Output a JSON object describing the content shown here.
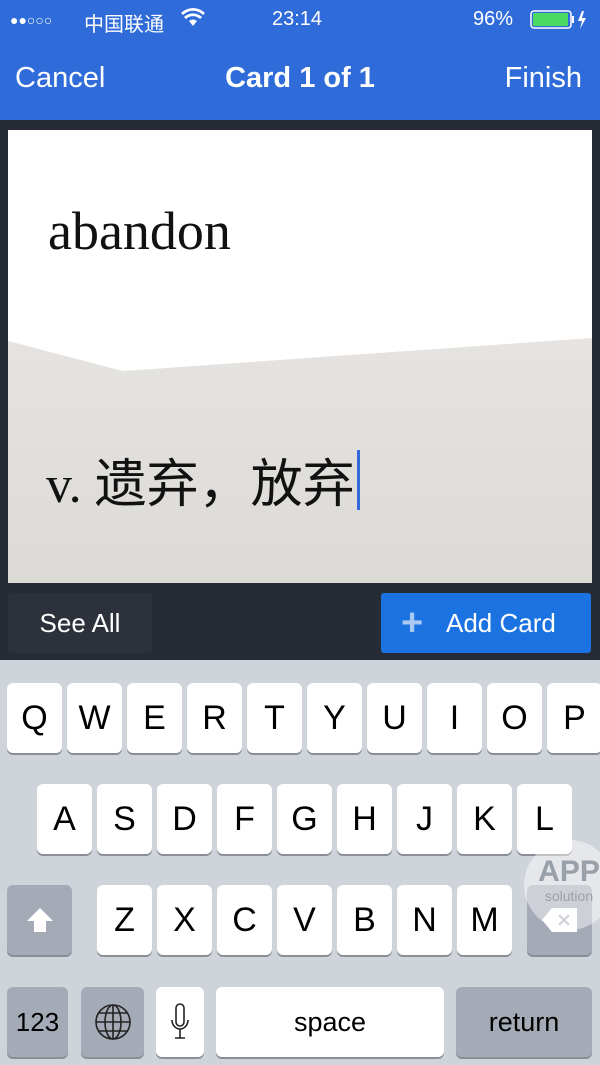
{
  "status_bar": {
    "signal": "●●○○○",
    "carrier": "中国联通",
    "time": "23:14",
    "battery": "96%",
    "battery_level": 0.96
  },
  "nav": {
    "cancel": "Cancel",
    "title": "Card 1 of 1",
    "finish": "Finish"
  },
  "card": {
    "front": "abandon",
    "back": "v. 遗弃，放弃"
  },
  "actions": {
    "see_all": "See All",
    "add_card": "Add Card"
  },
  "keyboard": {
    "row1": [
      "Q",
      "W",
      "E",
      "R",
      "T",
      "Y",
      "U",
      "I",
      "O",
      "P"
    ],
    "row2": [
      "A",
      "S",
      "D",
      "F",
      "G",
      "H",
      "J",
      "K",
      "L"
    ],
    "row3": [
      "Z",
      "X",
      "C",
      "V",
      "B",
      "N",
      "M"
    ],
    "numbers": "123",
    "space": "space",
    "return": "return"
  },
  "watermark": {
    "line1": "APP",
    "line2": "solution"
  },
  "colors": {
    "nav": "#2f6bd9",
    "add_button": "#1a73e0",
    "keyboard": "#cfd3da"
  }
}
